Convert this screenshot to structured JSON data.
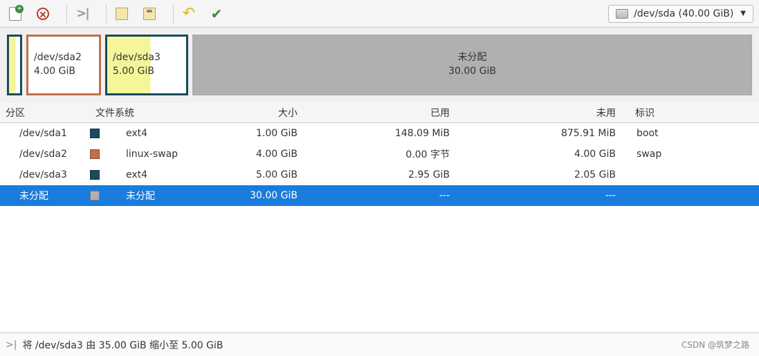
{
  "device_selector": {
    "label": "/dev/sda (40.00 GiB)"
  },
  "map": {
    "sda2": {
      "name": "/dev/sda2",
      "size": "4.00 GiB"
    },
    "sda3": {
      "name": "/dev/sda3",
      "size": "5.00 GiB"
    },
    "unalloc": {
      "label": "未分配",
      "size": "30.00 GiB"
    }
  },
  "columns": {
    "partition": "分区",
    "filesystem": "文件系统",
    "size": "大小",
    "used": "已用",
    "unused": "未用",
    "flags": "标识"
  },
  "rows": [
    {
      "partition": "/dev/sda1",
      "fs_color": "sw-ext4",
      "fs": "ext4",
      "size": "1.00 GiB",
      "used": "148.09 MiB",
      "unused": "875.91 MiB",
      "flags": "boot",
      "selected": false
    },
    {
      "partition": "/dev/sda2",
      "fs_color": "sw-swap",
      "fs": "linux-swap",
      "size": "4.00 GiB",
      "used": "0.00 字节",
      "unused": "4.00 GiB",
      "flags": "swap",
      "selected": false
    },
    {
      "partition": "/dev/sda3",
      "fs_color": "sw-ext4",
      "fs": "ext4",
      "size": "5.00 GiB",
      "used": "2.95 GiB",
      "unused": "2.05 GiB",
      "flags": "",
      "selected": false
    },
    {
      "partition": "未分配",
      "fs_color": "sw-unalloc",
      "fs": "未分配",
      "size": "30.00 GiB",
      "used": "---",
      "unused": "---",
      "flags": "",
      "selected": true
    }
  ],
  "status": {
    "message": "将 /dev/sda3 由 35.00 GiB 缩小至 5.00 GiB"
  },
  "watermark": "CSDN @筑梦之路"
}
